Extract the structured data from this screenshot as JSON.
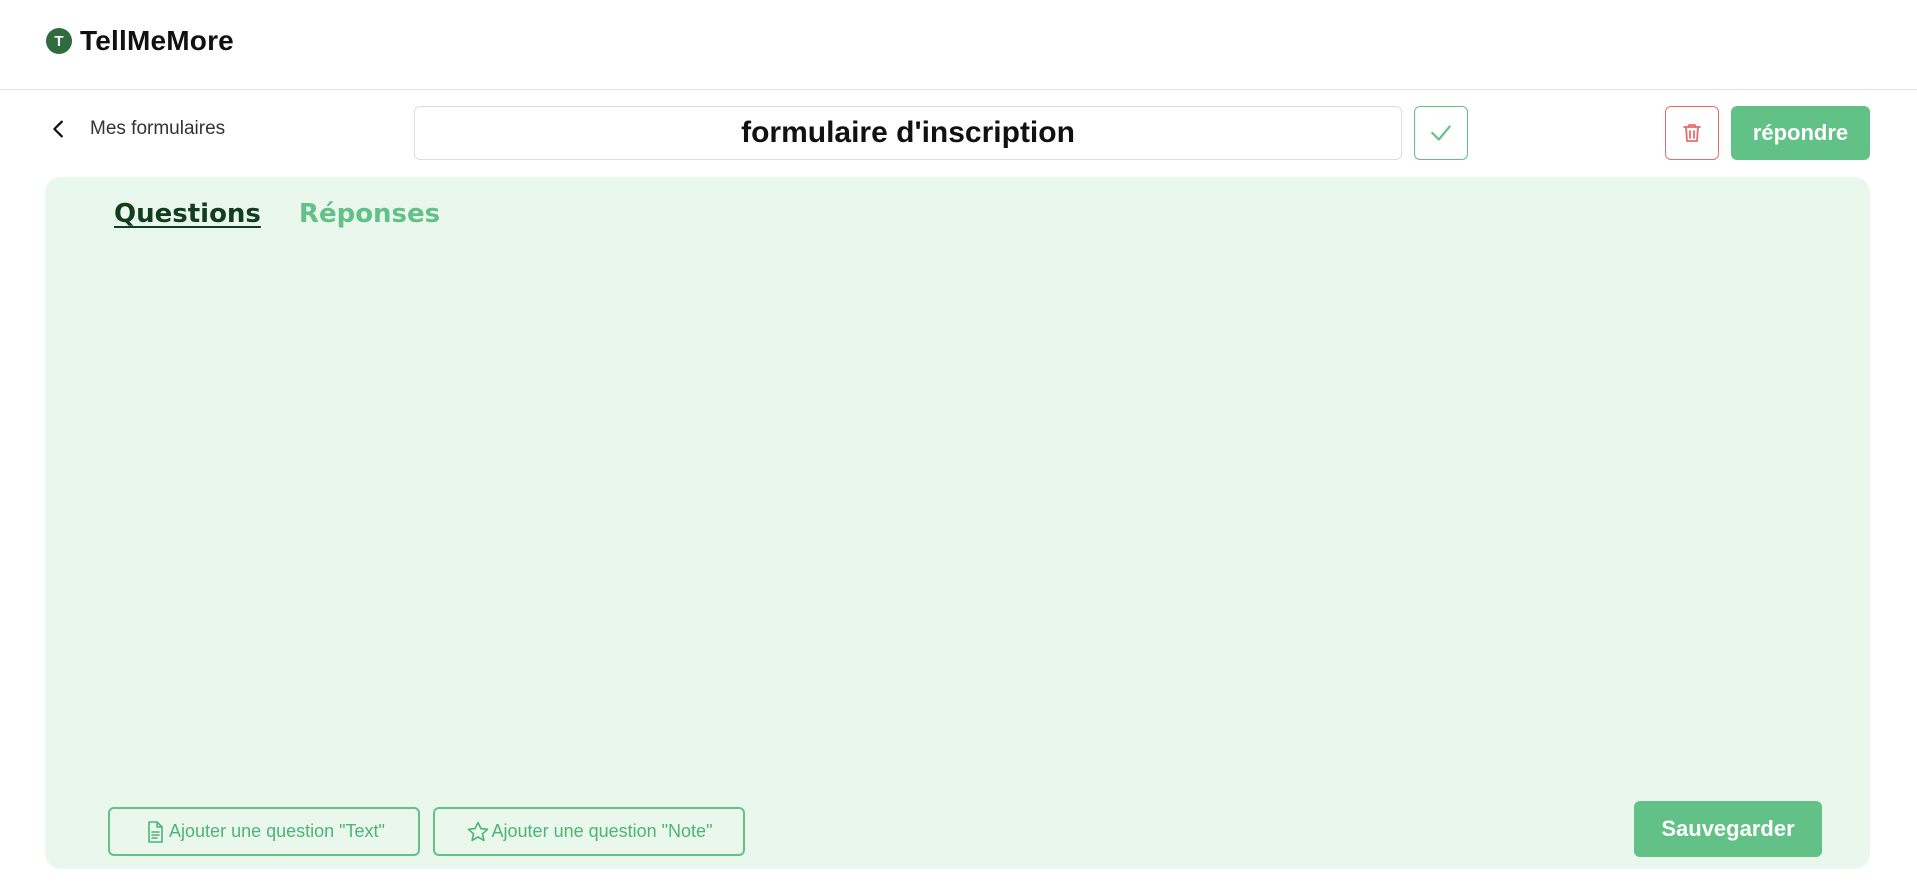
{
  "header": {
    "brand_icon_letter": "T",
    "brand_name": "TellMeMore"
  },
  "toolbar": {
    "back_label": "Mes formulaires",
    "form_title": "formulaire d'inscription",
    "respond_label": "répondre"
  },
  "tabs": [
    {
      "label": "Questions",
      "active": true
    },
    {
      "label": "Réponses",
      "active": false
    }
  ],
  "actions": {
    "add_text_label": "Ajouter une question \"Text\"",
    "add_note_label": "Ajouter une question \"Note\"",
    "save_label": "Sauvegarder"
  },
  "colors": {
    "accent": "#62c186",
    "brand_dark": "#2e6b3f",
    "panel_bg": "#eaf7ec",
    "danger": "#ec6b6b"
  }
}
